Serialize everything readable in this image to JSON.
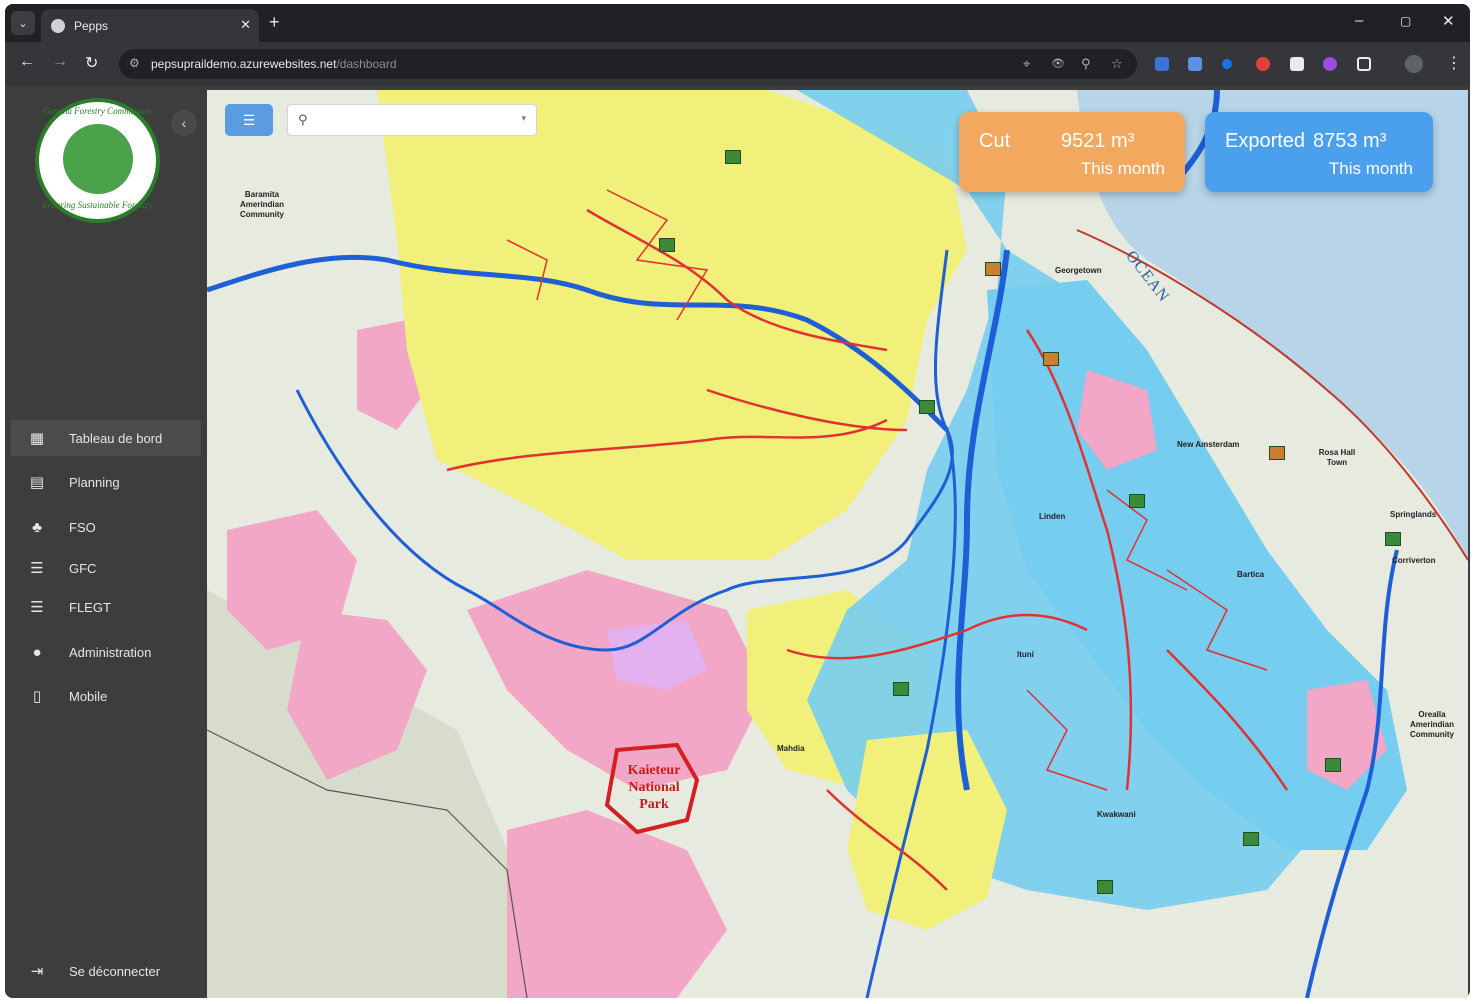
{
  "browser": {
    "tab_title": "Pepps",
    "url_host": "pepsupraildemo.azurewebsites.net",
    "url_path": "/dashboard"
  },
  "sidebar": {
    "logo_top_text": "Guyana Forestry Commission",
    "logo_bottom_text": "Ensuring Sustainable Forestry",
    "items": [
      {
        "label": "Tableau de bord",
        "icon": "dashboard-icon"
      },
      {
        "label": "Planning",
        "icon": "calendar-icon"
      },
      {
        "label": "FSO",
        "icon": "tree-icon"
      },
      {
        "label": "GFC",
        "icon": "checklist-icon"
      },
      {
        "label": "FLEGT",
        "icon": "checklist-icon"
      },
      {
        "label": "Administration",
        "icon": "user-icon"
      },
      {
        "label": "Mobile",
        "icon": "mobile-icon"
      }
    ],
    "logout_label": "Se déconnecter"
  },
  "map": {
    "search": {
      "placeholder": "",
      "value": ""
    },
    "cards": [
      {
        "label": "Cut",
        "value": "9521 m³",
        "period": "This month",
        "color": "#f2a85f"
      },
      {
        "label": "Exported",
        "value": "8753 m³",
        "period": "This month",
        "color": "#4ba0ee"
      }
    ],
    "labels": {
      "ocean": "OCEAN",
      "park": "Kaieteur National Park",
      "georgetown": "Georgetown",
      "new_amsterdam": "New Amsterdam",
      "linden": "Linden",
      "bartica": "Bartica",
      "mahdia": "Mahdia",
      "springlands": "Springlands",
      "corriverton": "Corriverton",
      "orealla": "Orealla Amerindian Community",
      "baramita": "Baramita Amerindian Community",
      "kwakwani": "Kwakwani",
      "ituni": "Ituni",
      "rosehall": "Rosa Hall Town"
    }
  }
}
